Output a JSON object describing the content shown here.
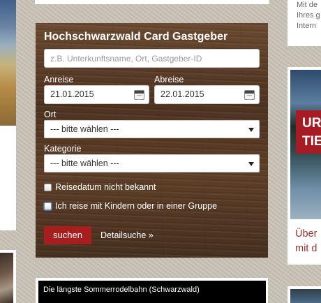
{
  "search_form": {
    "title": "Hochschwarzwald Card Gastgeber",
    "search_placeholder": "z.B. Unterkunftsname, Ort, Gastgeber-ID",
    "arrival_label": "Anreise",
    "arrival_value": "21.01.2015",
    "departure_label": "Abreise",
    "departure_value": "22.01.2015",
    "place_label": "Ort",
    "place_value": "--- bitte wählen ---",
    "category_label": "Kategorie",
    "category_value": "--- bitte wählen ---",
    "checkbox_date_unknown": "Reisedatum nicht bekannt",
    "checkbox_children_group": "Ich reise mit Kindern oder in einer Gruppe",
    "submit_label": "suchen",
    "detail_link_label": "Detailsuche »"
  },
  "video": {
    "title": "Die längste Sommerrodelbahn (Schwarzwald)"
  },
  "right_column": {
    "top_lines": [
      "Mit de",
      "Ihres g",
      "Intern"
    ],
    "promo_lines": [
      "UR",
      "TIE"
    ],
    "caption_lines": [
      "Über",
      "mit d"
    ]
  },
  "colors": {
    "accent_red": "#a81d1d",
    "panel_wood": "#5a3a24",
    "link_red": "#a3322a"
  }
}
